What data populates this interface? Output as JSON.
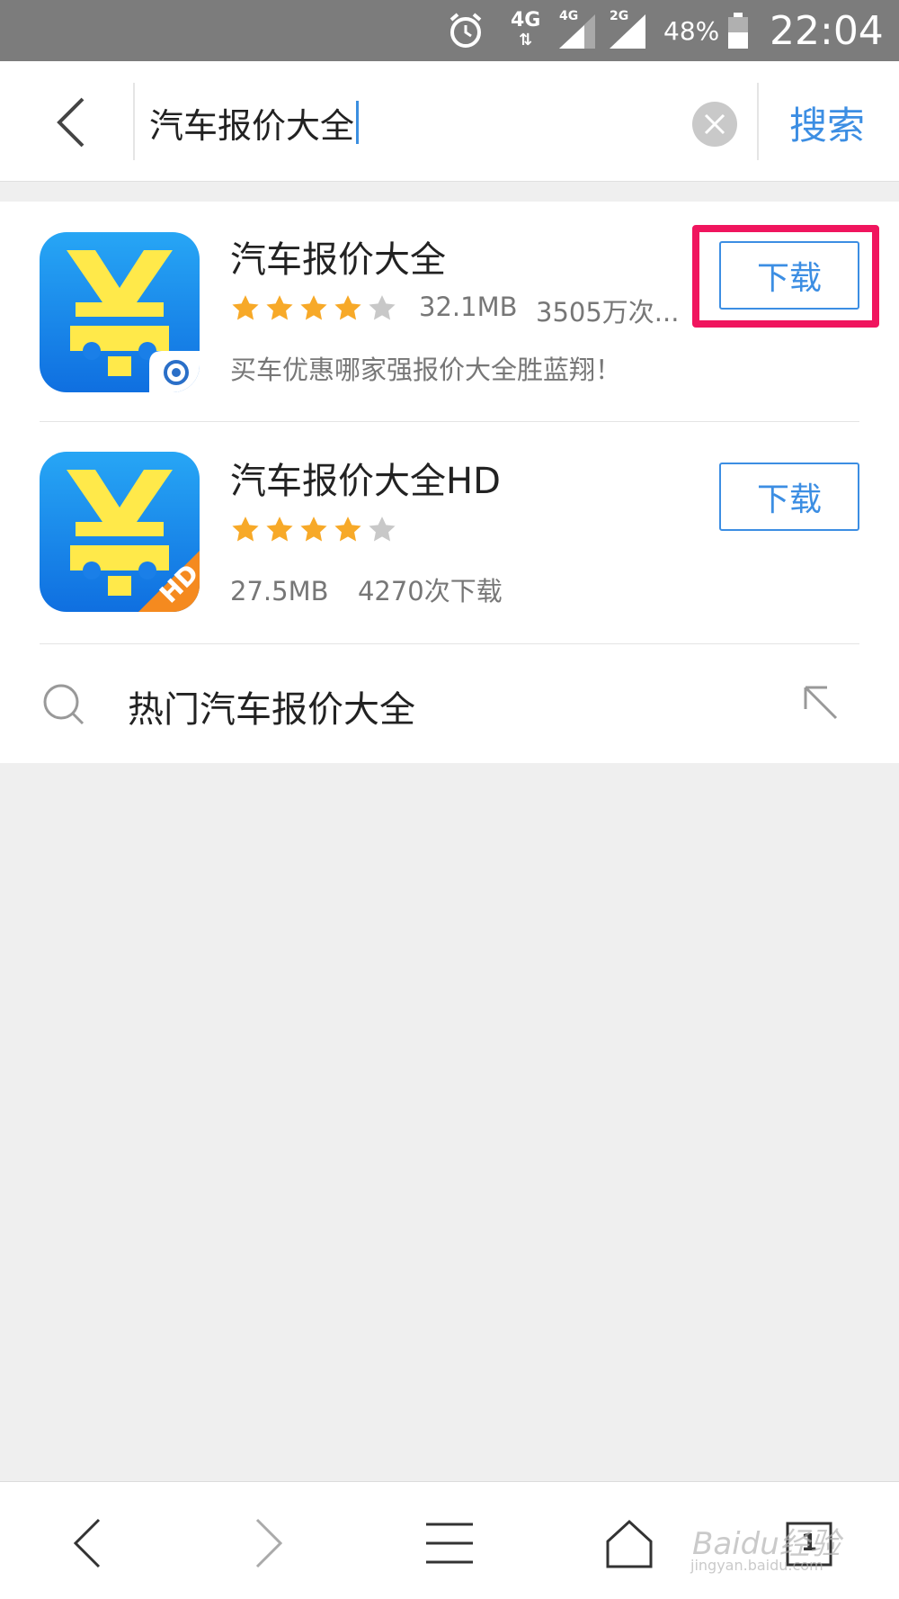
{
  "status_bar": {
    "network_1": "4G",
    "network_2": "4G",
    "network_3": "2G",
    "battery": "48%",
    "time": "22:04"
  },
  "search": {
    "query": "汽车报价大全",
    "search_label": "搜索"
  },
  "results": [
    {
      "title": "汽车报价大全",
      "rating": 4,
      "size": "32.1MB",
      "downloads": "3505万次...",
      "description": "买车优惠哪家强报价大全胜蓝翔！",
      "button": "下载"
    },
    {
      "title": "汽车报价大全HD",
      "rating": 4,
      "size": "27.5MB",
      "downloads": "4270次下载",
      "badge": "HD",
      "button": "下载"
    }
  ],
  "suggestion": {
    "text": "热门汽车报价大全"
  },
  "bottom_nav": {
    "tab_count": "1"
  },
  "watermark": {
    "brand": "Baidu经验",
    "url": "jingyan.baidu.com"
  },
  "colors": {
    "accent": "#3c8ee3",
    "highlight": "#f0155e",
    "star": "#f7a928",
    "icon_bg": "#1e8df0",
    "icon_symbol": "#ffe94a"
  }
}
